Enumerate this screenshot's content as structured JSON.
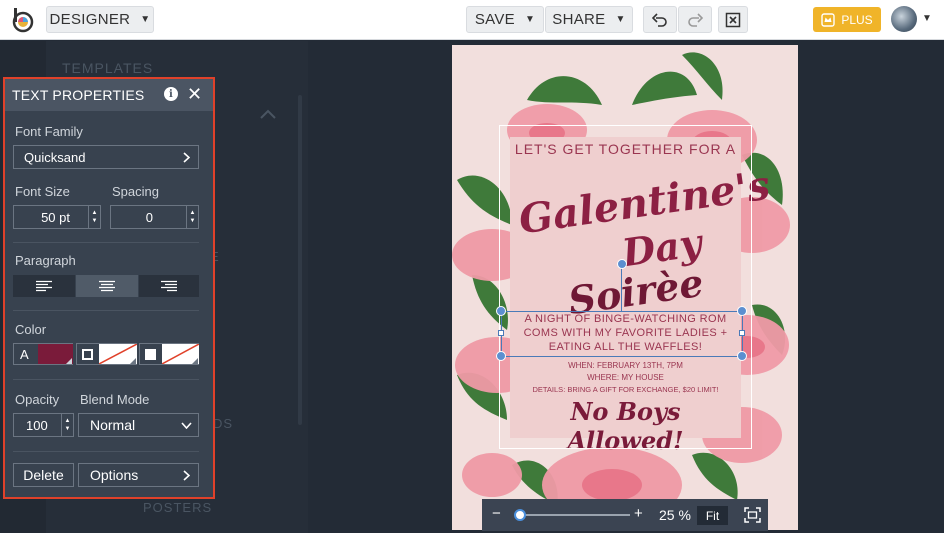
{
  "topbar": {
    "mode_label": "DESIGNER",
    "save_label": "SAVE",
    "share_label": "SHARE",
    "plus_label": "PLUS",
    "icons": [
      "app-logo",
      "undo-icon",
      "redo-icon",
      "close-doc-icon",
      "crown-icon",
      "avatar"
    ]
  },
  "background_sidebar": {
    "templates_label": "TEMPLATES",
    "partial_label_1": "E",
    "partial_label_2": "DS",
    "posters_label": "POSTERS"
  },
  "panel": {
    "title": "TEXT PROPERTIES",
    "font_family_label": "Font Family",
    "font_family_value": "Quicksand",
    "font_size_label": "Font Size",
    "font_size_value": "50 pt",
    "spacing_label": "Spacing",
    "spacing_value": "0",
    "paragraph_label": "Paragraph",
    "color_label": "Color",
    "color_a_label": "A",
    "text_color": "#7a1b3a",
    "opacity_label": "Opacity",
    "opacity_value": "100",
    "blend_mode_label": "Blend Mode",
    "blend_mode_value": "Normal",
    "delete_label": "Delete",
    "options_label": "Options"
  },
  "poster": {
    "line1": "LET'S GET TOGETHER FOR A",
    "script1": "Galentine's",
    "script2": "Day",
    "script3": "Soirèe",
    "desc1": "A NIGHT OF BINGE-WATCHING ROM",
    "desc2": "COMS WITH MY FAVORITE LADIES +",
    "desc3": "EATING ALL THE WAFFLES!",
    "when": "WHEN: FEBRUARY 13TH, 7PM",
    "where": "WHERE: MY HOUSE",
    "details": "DETAILS: BRING A GIFT FOR EXCHANGE, $20 LIMIT!",
    "closing": "No Boys Allowed!"
  },
  "zoom": {
    "minus": "−",
    "plus": "+",
    "level": "25 %",
    "fit_label": "Fit",
    "slider_value": 0.02
  }
}
